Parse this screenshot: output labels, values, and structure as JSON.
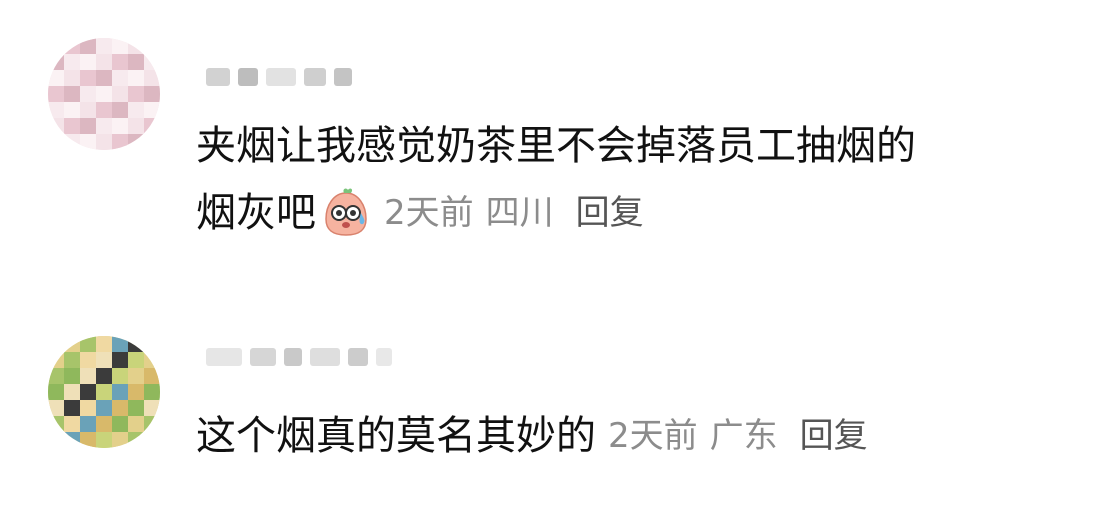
{
  "comments": [
    {
      "text_line1": "夹烟让我感觉奶茶里不会掉落员工抽烟的",
      "text_line2": "烟灰吧",
      "emoji_icon": "sweating-face-icon",
      "time": "2天前",
      "location": "四川",
      "reply_label": "回复"
    },
    {
      "text_line1": "这个烟真的莫名其妙的",
      "time": "2天前",
      "location": "广东",
      "reply_label": "回复"
    }
  ],
  "colors": {
    "text": "#111111",
    "meta": "#8c8c8c",
    "reply": "#555555"
  }
}
